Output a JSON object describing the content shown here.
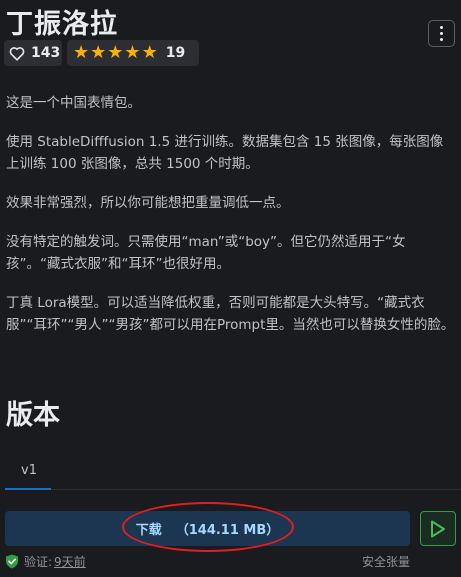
{
  "header": {
    "title": "丁振洛拉"
  },
  "stats": {
    "likes": "143",
    "rating_count": "19",
    "stars": 5
  },
  "description": [
    "这是一个中国表情包。",
    "使用 StableDifffusion 1.5 进行训练。数据集包含 15 张图像，每张图像上训练 100 张图像，总共 1500 个时期。",
    "效果非常强烈，所以你可能想把重量调低一点。",
    "没有特定的触发词。只需使用“man”或“boy”。但它仍然适用于“女孩”。“藏式衣服”和“耳环”也很好用。",
    "丁真 Lora模型。可以适当降低权重，否则可能都是大头特写。“藏式衣服”“耳环”“男人”“男孩”都可以用在Prompt里。当然也可以替换女性的脸。"
  ],
  "versions": {
    "title": "版本",
    "tab": "v1"
  },
  "download": {
    "label": "下载",
    "size": "（144.11 MB）"
  },
  "footer": {
    "verified_label": "验证:",
    "verified_time": "9天前",
    "safe_label": "安全张量"
  },
  "colors": {
    "background": "#1a1b1e",
    "star": "#fab005",
    "download_bg": "#1c3550",
    "download_text": "#a5d8ff",
    "play": "#2f9e44",
    "annotation": "#e41e1e"
  }
}
